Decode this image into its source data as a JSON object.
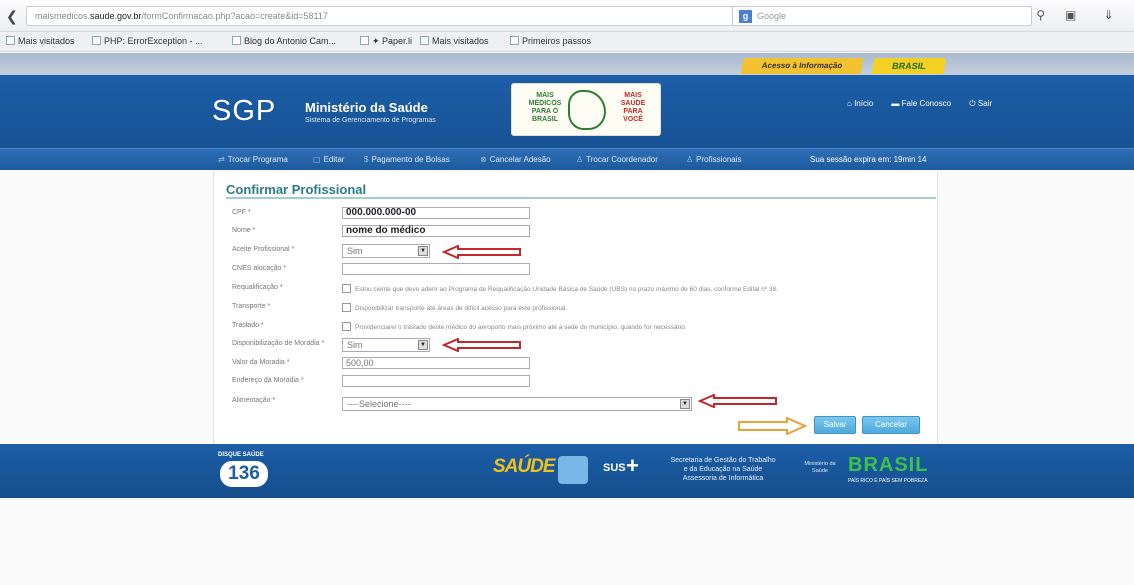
{
  "browser": {
    "url_prefix": "maismedicos.",
    "url_domain": "saude.gov.br",
    "url_path": "/formConfirmacao.php?acao=create&id=58117",
    "search_engine": "Google",
    "bookmarks": [
      {
        "label": "Mais visitados"
      },
      {
        "label": "PHP: ErrorException - ..."
      },
      {
        "label": "Blog do Antonio Cam..."
      },
      {
        "label": "✦ Paper.li"
      },
      {
        "label": "Mais visitados"
      },
      {
        "label": "Primeiros passos"
      }
    ]
  },
  "site": {
    "tab_access": "Acesso à Informação",
    "tab_brasil": "BRASIL",
    "logo": "SGP",
    "ministry": "Ministério da Saúde",
    "ministry_sub": "Sistema de Gerenciamento de Programas",
    "mm_left": "MAIS MÉDICOS PARA O BRASIL",
    "mm_right": "MAIS SAÚDE PARA VOCÊ",
    "links": [
      "Início",
      "Fale Conosco",
      "Sair"
    ],
    "nav": [
      "Trocar Programa",
      "Editar",
      "Pagamento de Bolsas",
      "Cancelar Adesão",
      "Trocar Coordenador",
      "Profissionais"
    ],
    "session": "Sua sessão expira em: 19min 14"
  },
  "form": {
    "title": "Confirmar Profissional",
    "cpf_label": "CPF *",
    "cpf_value": "000.000.000-00",
    "nome_label": "Nome *",
    "nome_value": "nome do médico",
    "aceite_label": "Aceite Profissional *",
    "aceite_value": "Sim",
    "cnes_label": "CNES alocação *",
    "requal_label": "Requalificação *",
    "requal_text": "Estou ciente que devo aderir ao Programa de Requalificação Unidade Básica de Saúde (UBS) no prazo máximo de 60 dias, conforme Edital nº 38.",
    "transp_label": "Transporte *",
    "transp_text": "Disponibilizar transporte até áreas de difícil acesso para este profissional.",
    "traslado_label": "Traslado *",
    "traslado_text": "Providenciarei o traslado deste médico do aeroporto mais próximo até a sede do município, quando for necessário.",
    "moradia_label": "Disponibilização de Moradia *",
    "moradia_value": "Sim",
    "valor_label": "Valor da Moradia *",
    "valor_value": "500,00",
    "endereco_label": "Endereço da Moradia *",
    "alim_label": "Alimentação *",
    "alim_value": "----Selecione----",
    "save": "Salvar",
    "cancel": "Cancelar"
  },
  "footer": {
    "top_label": "DISQUE SAÚDE",
    "number": "136",
    "saude": "SAÚDE",
    "sus": "SUS",
    "secretaria": "Secretaria de Gestão do Trabalho e da Educação na Saúde Assessoria de Informática",
    "ministerio": "Ministério da Saúde",
    "brasil": "BRASIL",
    "brasil_sub": "PAÍS RICO É PAÍS SEM POBREZA"
  },
  "colors": {
    "header_blue": "#1c5ea8",
    "title_teal": "#2a7c8a",
    "arrow_red": "#c0282d",
    "arrow_orange": "#e8a03a",
    "button_blue": "#4ea9dc"
  }
}
